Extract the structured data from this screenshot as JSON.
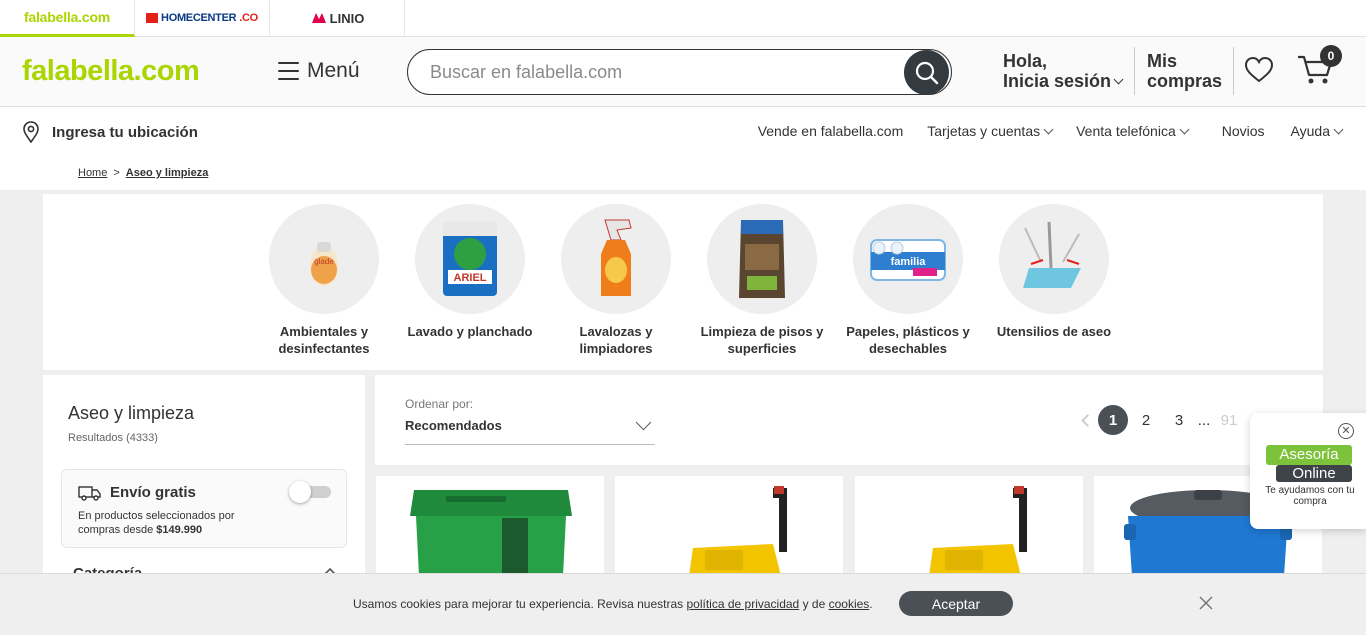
{
  "brand_tabs": [
    {
      "label": "falabella.com"
    },
    {
      "label": "HOMECENTER",
      "suffix": ".CO"
    },
    {
      "label": "LINIO"
    }
  ],
  "header": {
    "logo": "falabella.com",
    "menu_label": "Menú",
    "search_placeholder": "Buscar en falabella.com",
    "account_line1": "Hola,",
    "account_line2": "Inicia sesión",
    "purchases": "Mis compras",
    "cart_count": "0"
  },
  "location_bar": {
    "location_label": "Ingresa tu ubicación",
    "links": [
      "Vende en falabella.com",
      "Tarjetas y cuentas",
      "Venta telefónica",
      "Novios",
      "Ayuda"
    ]
  },
  "breadcrumb": {
    "home": "Home",
    "separator": ">",
    "current": "Aseo y limpieza"
  },
  "categories": [
    {
      "label": "Ambientales y desinfectantes"
    },
    {
      "label": "Lavado y planchado"
    },
    {
      "label": "Lavalozas y limpiadores"
    },
    {
      "label": "Limpieza de pisos y superficies"
    },
    {
      "label": "Papeles, plásticos y desechables"
    },
    {
      "label": "Utensilios de aseo"
    }
  ],
  "sidebar": {
    "title": "Aseo y limpieza",
    "results": "Resultados (4333)",
    "free_shipping": {
      "title": "Envío gratis",
      "desc_prefix": "En productos seleccionados por compras desde",
      "amount": "$149.990",
      "enabled": false
    },
    "category_heading": "Categoría"
  },
  "sort": {
    "label": "Ordenar por:",
    "value": "Recomendados"
  },
  "pagination": {
    "pages": [
      "1",
      "2",
      "3"
    ],
    "ellipsis": "...",
    "last": "91",
    "current": "1"
  },
  "chat": {
    "line1": "Asesoría",
    "line2": "Online",
    "subtitle": "Te ayudamos con tu compra"
  },
  "cookie": {
    "text_before": "Usamos cookies para mejorar tu experiencia. Revisa nuestras",
    "link1": "política de privacidad",
    "text_mid": "y de",
    "link2": "cookies",
    "text_end": ".",
    "accept": "Aceptar"
  },
  "colors": {
    "brand_green": "#aad500",
    "dark": "#333a40",
    "chat_green": "#7dc23b"
  }
}
